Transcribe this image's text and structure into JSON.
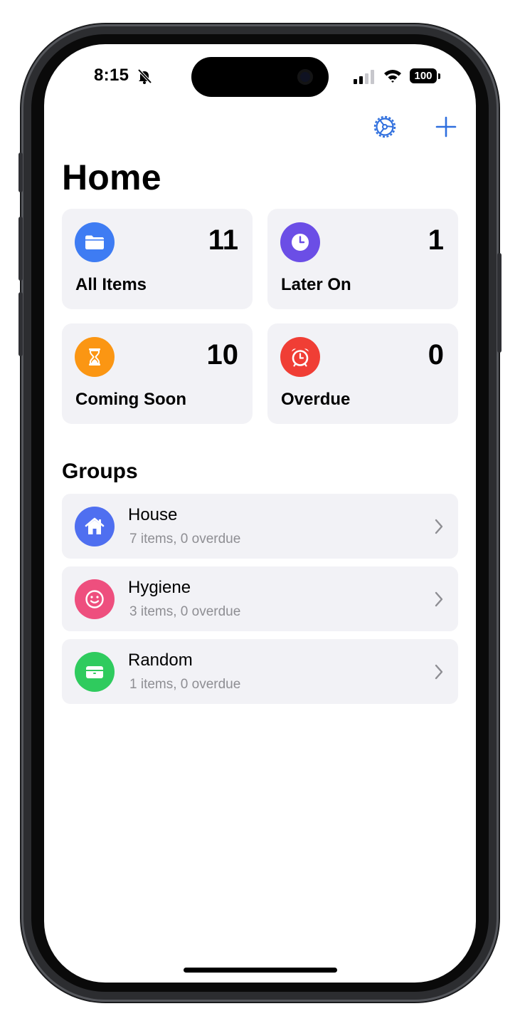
{
  "status_bar": {
    "time": "8:15",
    "battery": "100",
    "icons": [
      "bell-slash-icon",
      "cellular-signal-icon",
      "wifi-icon",
      "battery-icon"
    ]
  },
  "nav": {
    "settings_icon": "gear-icon",
    "add_icon": "plus-icon",
    "accent_color": "#2f6fde"
  },
  "title": "Home",
  "cards": [
    {
      "label": "All Items",
      "count": "11",
      "icon": "folder-icon",
      "color": "#3e7cf3"
    },
    {
      "label": "Later On",
      "count": "1",
      "icon": "clock-icon",
      "color": "#6b4ee6"
    },
    {
      "label": "Coming Soon",
      "count": "10",
      "icon": "hourglass-icon",
      "color": "#fb9613"
    },
    {
      "label": "Overdue",
      "count": "0",
      "icon": "alarm-clock-icon",
      "color": "#f03e35"
    }
  ],
  "groups_title": "Groups",
  "groups": [
    {
      "name": "House",
      "subtitle": "7 items, 0 overdue",
      "icon": "house-icon",
      "color": "#4f6ff0"
    },
    {
      "name": "Hygiene",
      "subtitle": "3 items, 0 overdue",
      "icon": "smiley-icon",
      "color": "#ee4f7e"
    },
    {
      "name": "Random",
      "subtitle": "1 items, 0 overdue",
      "icon": "box-icon",
      "color": "#2fcb5e"
    }
  ]
}
